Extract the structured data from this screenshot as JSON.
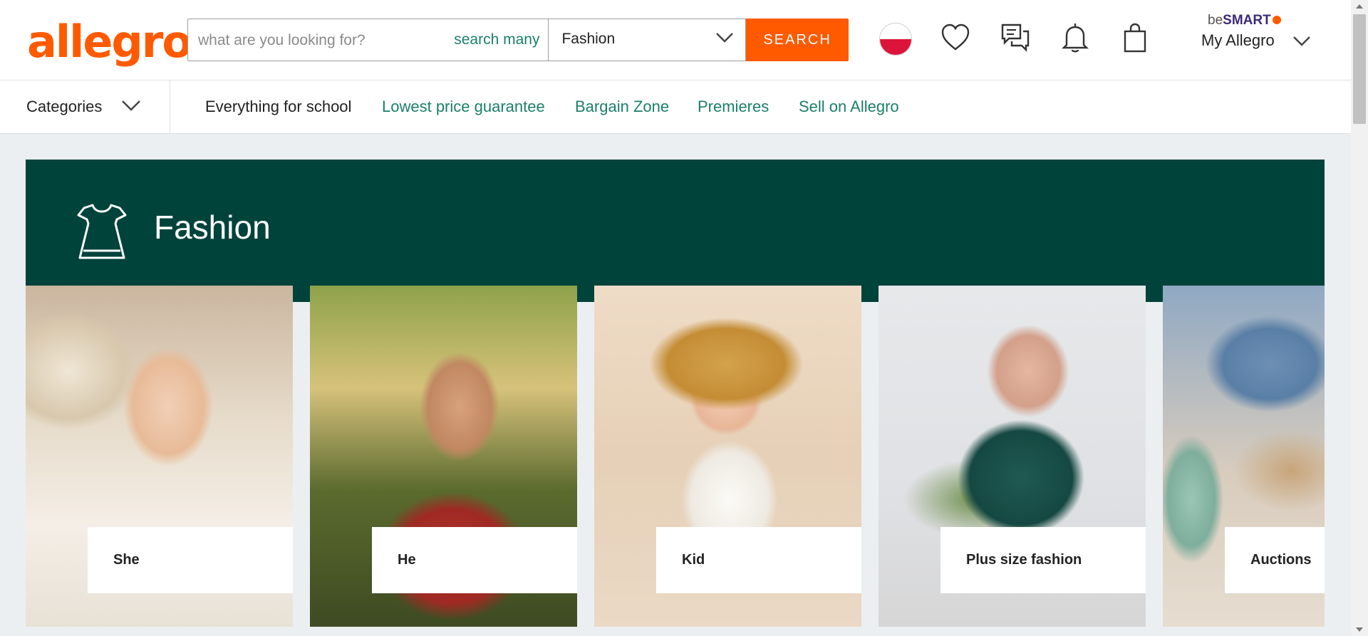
{
  "brand": {
    "logo_text": "allegro",
    "accent": "#ff5a00",
    "link_color": "#1b7f6b",
    "banner_color": "#00433b"
  },
  "search": {
    "placeholder": "what are you looking for?",
    "search_many": "search many",
    "category_value": "Fashion",
    "button_label": "SEARCH"
  },
  "header": {
    "icons": [
      "poland-flag-icon",
      "heart-icon",
      "chat-icon",
      "bell-icon",
      "shopping-bag-icon"
    ],
    "besmart_prefix": "be",
    "besmart_brand": "SMART",
    "my_allegro": "My Allegro"
  },
  "nav": {
    "categories_label": "Categories",
    "links": [
      "Everything for school",
      "Lowest price guarantee",
      "Bargain Zone",
      "Premieres",
      "Sell on Allegro"
    ]
  },
  "banner": {
    "title": "Fashion",
    "icon": "dress-icon"
  },
  "tiles": [
    "She",
    "He",
    "Kid",
    "Plus size fashion",
    "Auctions"
  ]
}
